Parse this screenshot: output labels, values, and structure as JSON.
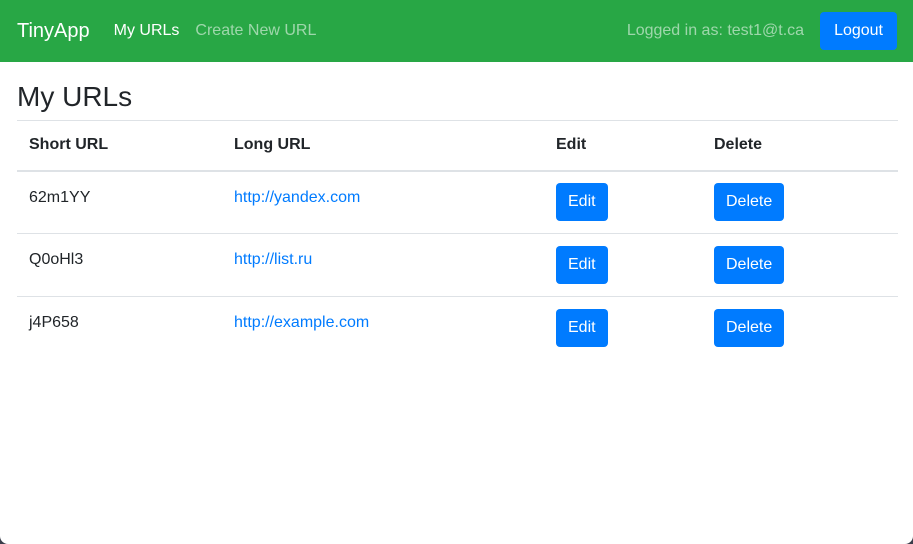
{
  "navbar": {
    "brand": "TinyApp",
    "links": [
      {
        "label": "My URLs"
      },
      {
        "label": "Create New URL"
      }
    ],
    "logged_in_text": "Logged in as: test1@t.ca",
    "logout_label": "Logout",
    "background_color": "#28a745"
  },
  "main": {
    "title": "My URLs",
    "table": {
      "headers": [
        "Short URL",
        "Long URL",
        "Edit",
        "Delete"
      ],
      "rows": [
        {
          "short": "62m1YY",
          "long": "http://yandex.com",
          "edit": "Edit",
          "delete": "Delete"
        },
        {
          "short": "Q0oHl3",
          "long": "http://list.ru",
          "edit": "Edit",
          "delete": "Delete"
        },
        {
          "short": "j4P658",
          "long": "http://example.com",
          "edit": "Edit",
          "delete": "Delete"
        }
      ]
    }
  },
  "colors": {
    "primary": "#007bff",
    "success": "#28a745"
  }
}
